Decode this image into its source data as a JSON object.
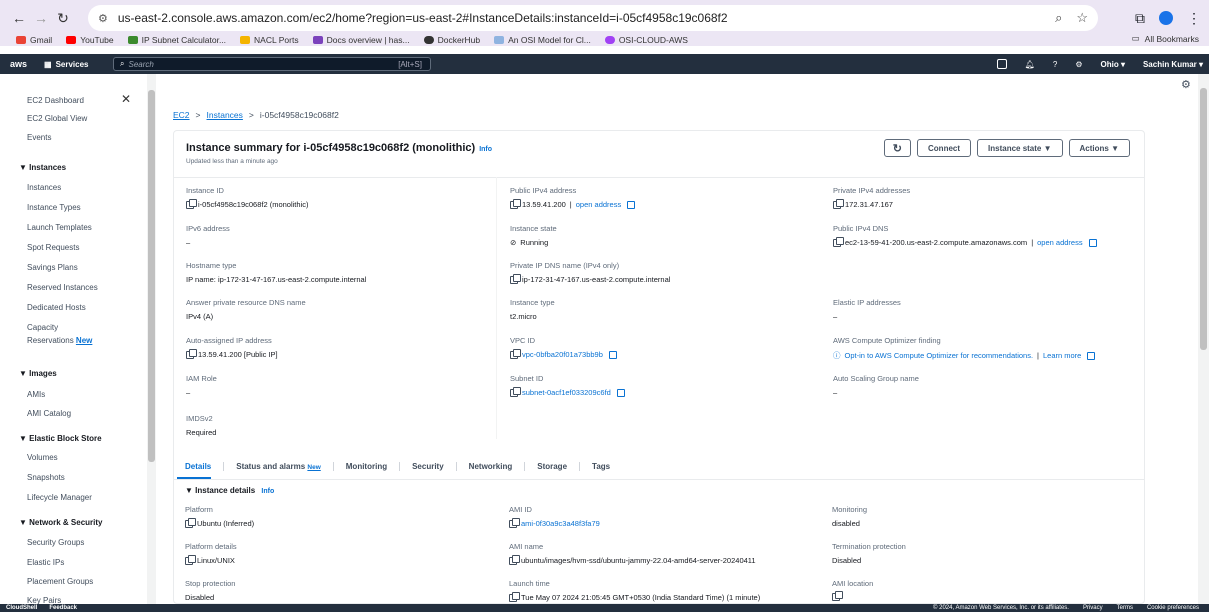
{
  "browser": {
    "url": "us-east-2.console.aws.amazon.com/ec2/home?region=us-east-2#InstanceDetails:instanceId=i-05cf4958c19c068f2",
    "bookmarks": [
      "Gmail",
      "YouTube",
      "IP Subnet Calculator...",
      "NACL Ports",
      "Docs overview | has...",
      "DockerHub",
      "An OSI Model for Cl...",
      "OSI-CLOUD-AWS"
    ],
    "all_bookmarks": "All Bookmarks"
  },
  "aws_nav": {
    "logo": "aws",
    "services": "Services",
    "search_placeholder": "Search",
    "search_shortcut": "[Alt+S]",
    "region": "Ohio ▾",
    "user": "Sachin Kumar ▾"
  },
  "sidebar": {
    "top_items": [
      "EC2 Dashboard",
      "EC2 Global View",
      "Events"
    ],
    "sections": [
      {
        "title": "▼ Instances",
        "items": [
          "Instances",
          "Instance Types",
          "Launch Templates",
          "Spot Requests",
          "Savings Plans",
          "Reserved Instances",
          "Dedicated Hosts",
          "Capacity",
          "Reservations"
        ]
      },
      {
        "title": "▼ Images",
        "items": [
          "AMIs",
          "AMI Catalog"
        ]
      },
      {
        "title": "▼ Elastic Block Store",
        "items": [
          "Volumes",
          "Snapshots",
          "Lifecycle Manager"
        ]
      },
      {
        "title": "▼ Network & Security",
        "items": [
          "Security Groups",
          "Elastic IPs",
          "Placement Groups",
          "Key Pairs"
        ]
      }
    ],
    "new_badge": "New"
  },
  "breadcrumb": {
    "root": "EC2",
    "section": "Instances",
    "current": "i-05cf4958c19c068f2"
  },
  "summary": {
    "title": "Instance summary for i-05cf4958c19c068f2 (monolithic)",
    "info": "Info",
    "subtitle": "Updated less than a minute ago",
    "buttons": {
      "refresh": "↻",
      "connect": "Connect",
      "instance_state": "Instance state ▼",
      "actions": "Actions ▼"
    }
  },
  "fields": {
    "instance_id": {
      "label": "Instance ID",
      "value": "i-05cf4958c19c068f2 (monolithic)"
    },
    "public_ipv4": {
      "label": "Public IPv4 address",
      "value": "13.59.41.200",
      "link": "open address"
    },
    "private_ipv4": {
      "label": "Private IPv4 addresses",
      "value": "172.31.47.167"
    },
    "ipv6": {
      "label": "IPv6 address",
      "value": "–"
    },
    "instance_state": {
      "label": "Instance state",
      "value": "Running"
    },
    "public_dns": {
      "label": "Public IPv4 DNS",
      "value": "ec2-13-59-41-200.us-east-2.compute.amazonaws.com",
      "link": "open address"
    },
    "hostname_type": {
      "label": "Hostname type",
      "value": "IP name: ip-172-31-47-167.us-east-2.compute.internal"
    },
    "private_dns": {
      "label": "Private IP DNS name (IPv4 only)",
      "value": "ip-172-31-47-167.us-east-2.compute.internal"
    },
    "answer_dns": {
      "label": "Answer private resource DNS name",
      "value": "IPv4 (A)"
    },
    "instance_type": {
      "label": "Instance type",
      "value": "t2.micro"
    },
    "elastic_ip": {
      "label": "Elastic IP addresses",
      "value": "–"
    },
    "auto_ip": {
      "label": "Auto-assigned IP address",
      "value": "13.59.41.200 [Public IP]"
    },
    "vpc_id": {
      "label": "VPC ID",
      "value": "vpc-0bfba20f01a73bb9b"
    },
    "optimizer": {
      "label": "AWS Compute Optimizer finding",
      "value": "Opt-in to AWS Compute Optimizer for recommendations.",
      "link": "Learn more"
    },
    "iam_role": {
      "label": "IAM Role",
      "value": "–"
    },
    "subnet_id": {
      "label": "Subnet ID",
      "value": "subnet-0acf1ef033209c6fd"
    },
    "asg": {
      "label": "Auto Scaling Group name",
      "value": "–"
    },
    "imdsv2": {
      "label": "IMDSv2",
      "value": "Required"
    }
  },
  "tabs": [
    "Details",
    "Status and alarms",
    "Monitoring",
    "Security",
    "Networking",
    "Storage",
    "Tags"
  ],
  "details": {
    "title": "▼ Instance details",
    "info": "Info",
    "platform": {
      "label": "Platform",
      "value": "Ubuntu (Inferred)"
    },
    "ami_id": {
      "label": "AMI ID",
      "value": "ami-0f30a9c3a48f3fa79"
    },
    "monitoring": {
      "label": "Monitoring",
      "value": "disabled"
    },
    "platform_details": {
      "label": "Platform details",
      "value": "Linux/UNIX"
    },
    "ami_name": {
      "label": "AMI name",
      "value": "ubuntu/images/hvm-ssd/ubuntu-jammy-22.04-amd64-server-20240411"
    },
    "termination": {
      "label": "Termination protection",
      "value": "Disabled"
    },
    "stop_protection": {
      "label": "Stop protection",
      "value": "Disabled"
    },
    "launch_time": {
      "label": "Launch time",
      "value": "Tue May 07 2024 21:05:45 GMT+0530 (India Standard Time) (1 minute)"
    },
    "ami_location": {
      "label": "AMI location",
      "value": ""
    }
  },
  "footer": {
    "cloudshell": "CloudShell",
    "feedback": "Feedback",
    "copyright": "© 2024, Amazon Web Services, Inc. or its affiliates.",
    "privacy": "Privacy",
    "terms": "Terms",
    "cookies": "Cookie preferences"
  }
}
